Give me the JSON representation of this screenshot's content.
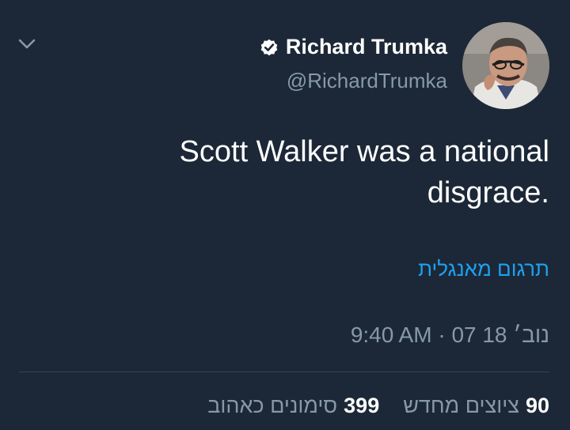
{
  "tweet": {
    "author": {
      "display_name": "Richard Trumka",
      "handle": "@RichardTrumka",
      "verified": true,
      "avatar_icon": "profile-photo"
    },
    "text": "Scott Walker was a national disgrace.",
    "translate_link": "תרגום מאנגלית",
    "time": "9:40 AM",
    "separator": " · ",
    "date": "07 18 נוב׳",
    "stats": {
      "retweets_count": "90",
      "retweets_label": "ציוצים מחדש",
      "likes_count": "399",
      "likes_label": "סימונים כאהוב"
    }
  },
  "icons": {
    "menu": "chevron-down-icon",
    "verified": "verified-badge-icon"
  },
  "colors": {
    "background": "#1c2837",
    "text_primary": "#ffffff",
    "text_secondary": "#8899a6",
    "link": "#1da1f2",
    "divider": "#38444d"
  }
}
